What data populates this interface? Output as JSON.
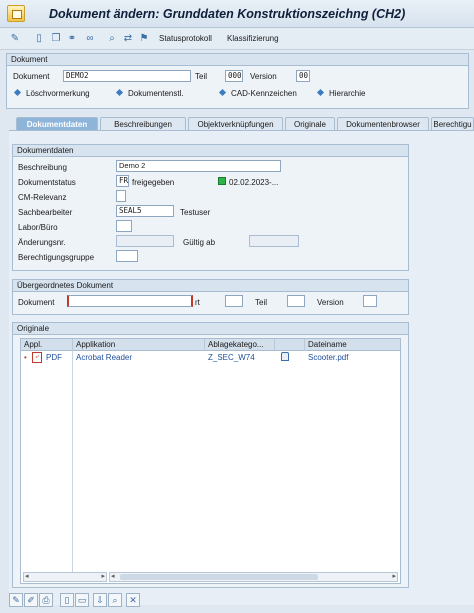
{
  "window": {
    "title": "Dokument ändern: Grunddaten  Konstruktionszeichng (CH2)"
  },
  "toolbar": {
    "icons": [
      "pencil-glasses-icon",
      "new-document-icon",
      "copy-document-icon",
      "link-icon",
      "binoculars-icon",
      "find-icon",
      "transfer-icon",
      "hierarchy-icon"
    ],
    "status_protocol_label": "Statusprotokoll",
    "classification_label": "Klassifizierung"
  },
  "header_panel": {
    "title": "Dokument",
    "document_label": "Dokument",
    "document_value": "DEMO2",
    "part_label": "Teil",
    "part_value": "000",
    "version_label": "Version",
    "version_value": "00",
    "links": [
      "Löschvormerkung",
      "Dokumentenstl.",
      "CAD-Kennzeichen",
      "Hierarchie"
    ]
  },
  "tabs": [
    "Dokumentdaten",
    "Beschreibungen",
    "Objektverknüpfungen",
    "Originale",
    "Dokumentenbrowser",
    "Berechtigu"
  ],
  "document_data": {
    "title": "Dokumentdaten",
    "description_label": "Beschreibung",
    "description_value": "Demo 2",
    "status_label": "Dokumentstatus",
    "status_code": "FR",
    "status_text": "freigegeben",
    "status_color": "#2fb34a",
    "status_date": "02.02.2023-...",
    "cm_label": "CM-Relevanz",
    "clerk_label": "Sachbearbeiter",
    "clerk_value": "SEAL5",
    "clerk_name": "Testuser",
    "lab_label": "Labor/Büro",
    "change_label": "Änderungsnr.",
    "valid_from_label": "Gültig ab",
    "auth_group_label": "Berechtigungsgruppe"
  },
  "superior_document": {
    "title": "Übergeordnetes Dokument",
    "document_label": "Dokument",
    "type_label": "rt",
    "part_label": "Teil",
    "version_label": "Version"
  },
  "originals": {
    "title": "Originale",
    "columns": [
      "Appl.",
      "Applikation",
      "Ablagekatego...",
      "",
      "Dateiname"
    ],
    "rows": [
      {
        "appl": "PDF",
        "application": "Acrobat Reader",
        "storage": "Z_SEC_W74",
        "filename": "Scooter.pdf"
      }
    ]
  }
}
